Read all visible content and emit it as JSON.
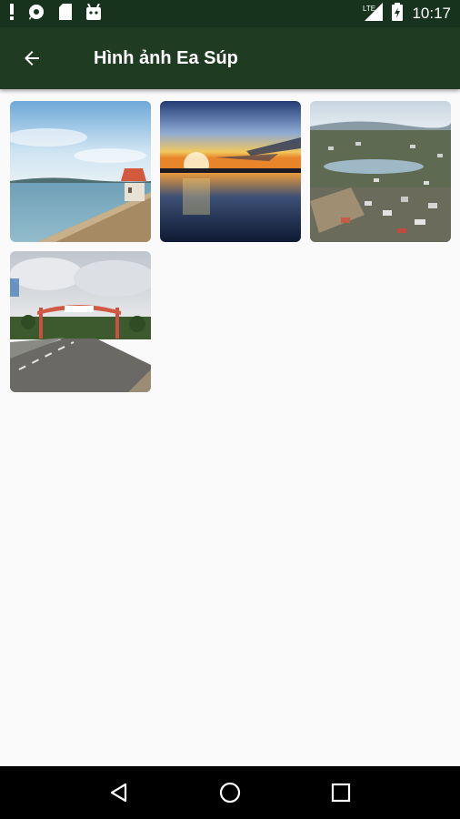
{
  "status_bar": {
    "time": "10:17",
    "network": "LTE",
    "icons_left": [
      "alert-icon",
      "chat-icon",
      "sd-card-icon",
      "android-icon"
    ]
  },
  "app_bar": {
    "title": "Hình ảnh Ea Súp",
    "back_icon": "arrow-back-icon",
    "color": "#1f3c23"
  },
  "gallery": {
    "items": [
      {
        "name": "lake-with-tower",
        "icon": "photo"
      },
      {
        "name": "sunset-lake",
        "icon": "photo"
      },
      {
        "name": "aerial-town",
        "icon": "photo"
      },
      {
        "name": "road-gate",
        "icon": "photo"
      }
    ]
  },
  "nav_bar": {
    "buttons": [
      "back-nav",
      "home-nav",
      "recents-nav"
    ]
  }
}
